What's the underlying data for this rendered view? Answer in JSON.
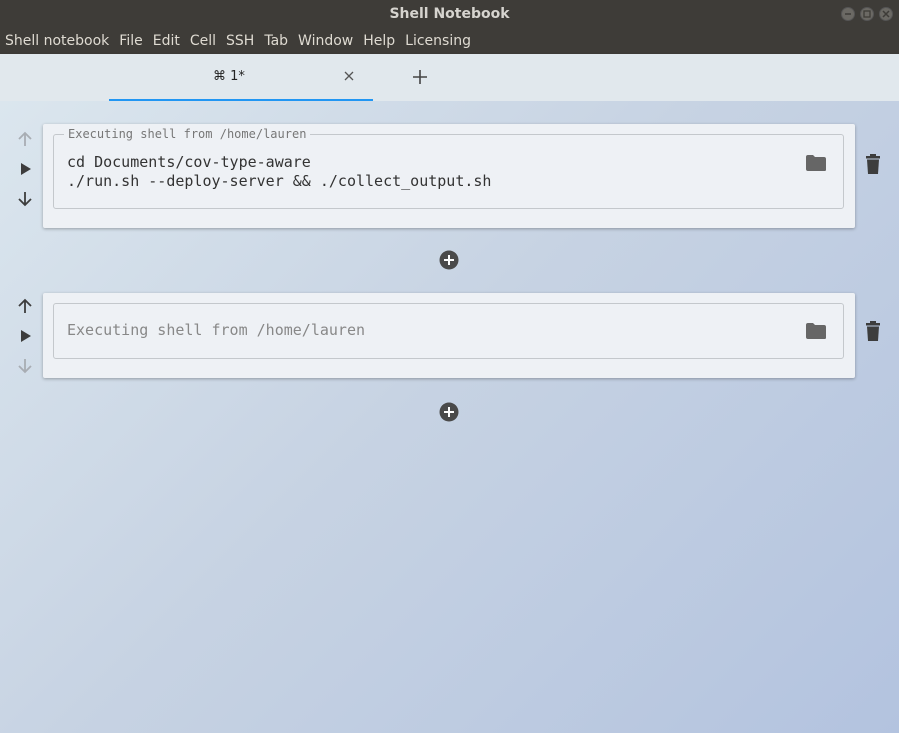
{
  "window": {
    "title": "Shell Notebook"
  },
  "menubar": {
    "items": [
      "Shell notebook",
      "File",
      "Edit",
      "Cell",
      "SSH",
      "Tab",
      "Window",
      "Help",
      "Licensing"
    ]
  },
  "tabs": [
    {
      "label": "⌘ 1*",
      "active": true
    }
  ],
  "cells": [
    {
      "legend": "Executing shell from /home/lauren",
      "code_lines": [
        "cd Documents/cov-type-aware",
        "./run.sh --deploy-server && ./collect_output.sh"
      ]
    },
    {
      "placeholder": "Executing shell from /home/lauren"
    }
  ],
  "icons": {
    "move_up": "arrow-up-icon",
    "run": "play-icon",
    "move_down": "arrow-down-icon",
    "folder": "folder-icon",
    "delete": "trash-icon",
    "add_cell": "plus-circle-icon"
  },
  "colors": {
    "accent": "#2196f3",
    "titlebar": "#3e3c38",
    "icon": "#555555"
  }
}
